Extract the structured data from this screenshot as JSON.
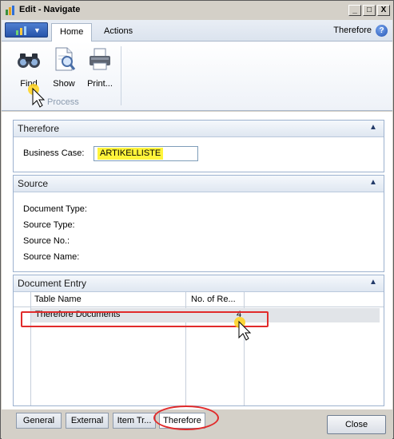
{
  "window": {
    "title": "Edit - Navigate",
    "min": "_",
    "max": "□",
    "close": "X"
  },
  "ribbon": {
    "app_button_icon": "dynamics-bars-icon",
    "tabs": [
      "Home",
      "Actions"
    ],
    "context_label": "Therefore",
    "help_glyph": "?",
    "buttons": [
      {
        "label": "Find",
        "icon": "binoculars-icon"
      },
      {
        "label": "Show",
        "icon": "document-magnifier-icon"
      },
      {
        "label": "Print...",
        "icon": "printer-icon"
      }
    ],
    "group_label": "Process"
  },
  "sections": {
    "therefore": {
      "title": "Therefore",
      "business_case_label": "Business Case:",
      "business_case_value": "ARTIKELLISTE"
    },
    "source": {
      "title": "Source",
      "labels": [
        "Document Type:",
        "Source Type:",
        "Source No.:",
        "Source Name:"
      ]
    },
    "document_entry": {
      "title": "Document Entry",
      "columns": [
        "Table Name",
        "No. of Re..."
      ],
      "rows": [
        {
          "table_name": "Therefore Documents",
          "count": "4"
        }
      ]
    }
  },
  "footer": {
    "tabs": [
      "General",
      "External",
      "Item Tr...",
      "Therefore"
    ],
    "close_label": "Close"
  },
  "colors": {
    "highlight": "#fff43a",
    "annotation": "#e12b2b",
    "accent": "#2653a9"
  }
}
